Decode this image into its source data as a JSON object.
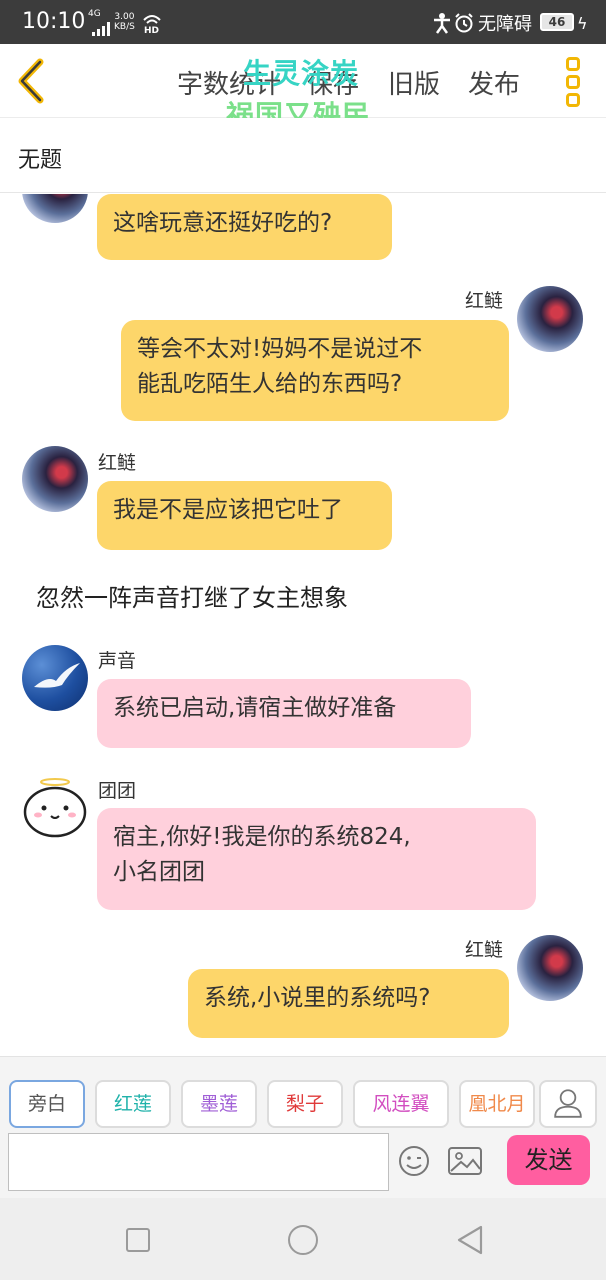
{
  "status_bar": {
    "time": "10:10",
    "net_type": "4G",
    "net_speed": "3.00",
    "net_speed_unit": "KB/S",
    "hd": "HD",
    "accessibility_label": "无障碍",
    "battery": "46"
  },
  "header": {
    "items": [
      "字数统计",
      "保存",
      "旧版",
      "发布"
    ]
  },
  "watermark": {
    "line1": "生灵涂炭",
    "line2": "祸国又殃民"
  },
  "title": "无题",
  "messages": [
    {
      "name": "",
      "text": "这啥玩意还挺好吃的?"
    },
    {
      "name": "红鲢",
      "text_lines": [
        "等会不太对!妈妈不是说过不",
        "能乱吃陌生人给的东西吗?"
      ]
    },
    {
      "name": "红鲢",
      "text": "我是不是应该把它吐了"
    },
    {
      "narration": "忽然一阵声音打继了女主想象"
    },
    {
      "name": "声音",
      "text": "系统已启动,请宿主做好准备"
    },
    {
      "name": "团团",
      "text_lines": [
        "宿主,你好!我是你的系统824,",
        "小名团团"
      ]
    },
    {
      "name": "红鲢",
      "text": "系统,小说里的系统吗?"
    }
  ],
  "character_chips": [
    {
      "label": "旁白",
      "color": "#555555"
    },
    {
      "label": "红莲",
      "color": "#20b2aa"
    },
    {
      "label": "墨莲",
      "color": "#a05fd6"
    },
    {
      "label": "梨子",
      "color": "#e03a3a"
    },
    {
      "label": "风连翼",
      "color": "#d24ec0"
    },
    {
      "label": "凰北月",
      "color": "#f08a4b"
    }
  ],
  "composer": {
    "placeholder": "",
    "send_label": "发送"
  },
  "colors": {
    "accent_yellow": "#fdd66a",
    "bubble_pink": "#ffd0dc",
    "send_pink": "#ff5ea0",
    "menu_gold": "#f2b705"
  }
}
